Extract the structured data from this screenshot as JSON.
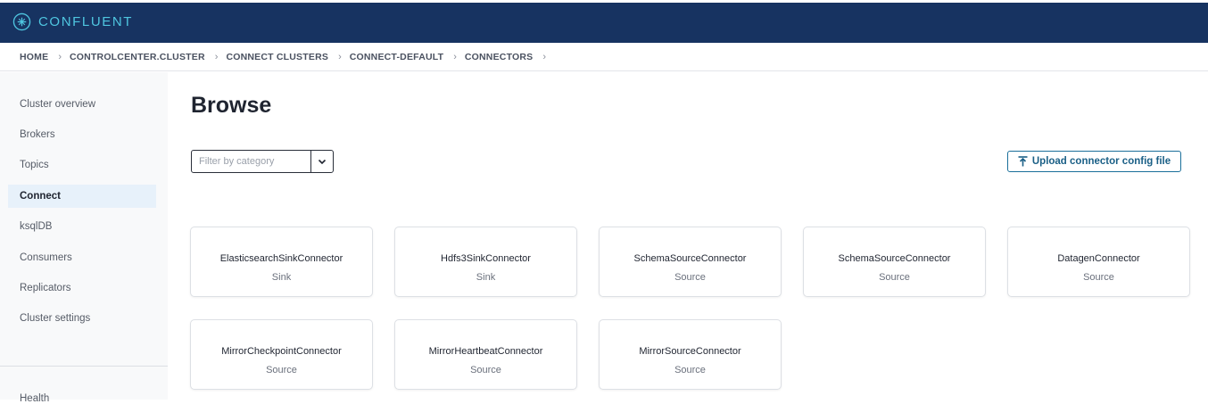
{
  "header": {
    "brand": "CONFLUENT"
  },
  "breadcrumb": [
    "HOME",
    "CONTROLCENTER.CLUSTER",
    "CONNECT CLUSTERS",
    "CONNECT-DEFAULT",
    "CONNECTORS"
  ],
  "sidebar": {
    "items": [
      {
        "label": "Cluster overview",
        "active": false
      },
      {
        "label": "Brokers",
        "active": false
      },
      {
        "label": "Topics",
        "active": false
      },
      {
        "label": "Connect",
        "active": true
      },
      {
        "label": "ksqlDB",
        "active": false
      },
      {
        "label": "Consumers",
        "active": false
      },
      {
        "label": "Replicators",
        "active": false
      },
      {
        "label": "Cluster settings",
        "active": false
      }
    ],
    "cut_item": "Health"
  },
  "main": {
    "title": "Browse",
    "filter_placeholder": "Filter by category",
    "upload_label": "Upload connector config file"
  },
  "connectors": [
    {
      "name": "ElasticsearchSinkConnector",
      "type": "Sink"
    },
    {
      "name": "Hdfs3SinkConnector",
      "type": "Sink"
    },
    {
      "name": "SchemaSourceConnector",
      "type": "Source"
    },
    {
      "name": "SchemaSourceConnector",
      "type": "Source"
    },
    {
      "name": "DatagenConnector",
      "type": "Source"
    },
    {
      "name": "MirrorCheckpointConnector",
      "type": "Source"
    },
    {
      "name": "MirrorHeartbeatConnector",
      "type": "Source"
    },
    {
      "name": "MirrorSourceConnector",
      "type": "Source"
    }
  ],
  "colors": {
    "header_bg": "#173361",
    "brand": "#4fc6e0",
    "active_nav_bg": "#e7f1fa",
    "accent": "#1a6f9a"
  }
}
